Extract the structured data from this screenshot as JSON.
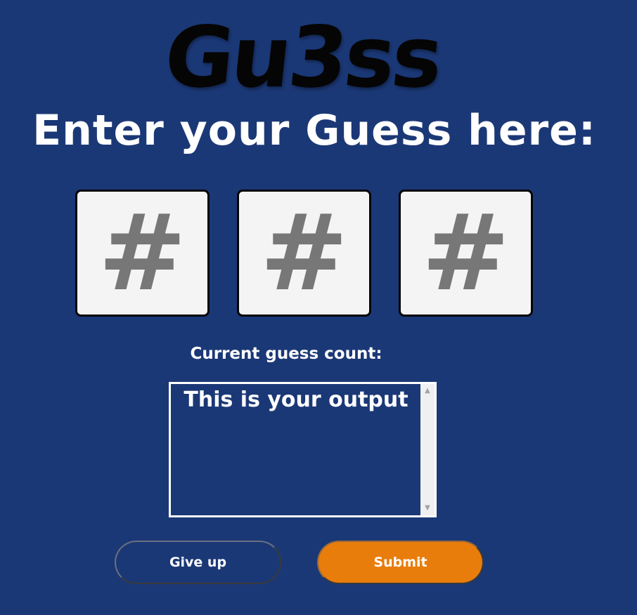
{
  "app": {
    "logo_text": "Gu3ss",
    "prompt": "Enter your Guess here:"
  },
  "guess_inputs": [
    {
      "placeholder": "#",
      "value": ""
    },
    {
      "placeholder": "#",
      "value": ""
    },
    {
      "placeholder": "#",
      "value": ""
    }
  ],
  "count": {
    "label": "Current guess count:"
  },
  "output": {
    "text": "This is your output"
  },
  "buttons": {
    "give_up_label": "Give up",
    "submit_label": "Submit"
  },
  "colors": {
    "background": "#1b3876",
    "accent": "#e87d0c",
    "input_background": "#f4f4f4"
  }
}
